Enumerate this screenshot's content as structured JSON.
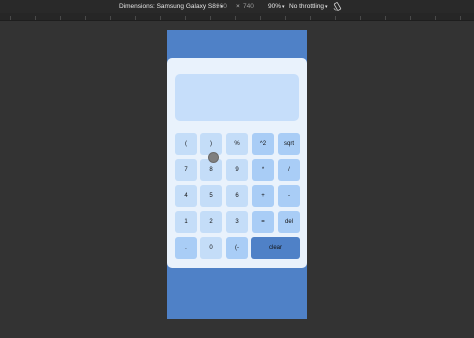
{
  "devtools": {
    "dimensions_label": "Dimensions: Samsung Galaxy S8+",
    "width": "360",
    "times": "×",
    "height": "740",
    "zoom": "90%",
    "throttling": "No throttling"
  },
  "calculator": {
    "display_value": "",
    "keys": {
      "open_paren": "(",
      "close_paren": ")",
      "percent": "%",
      "square": "^2",
      "sqrt": "sqrt",
      "seven": "7",
      "eight": "8",
      "nine": "9",
      "multiply": "*",
      "divide": "/",
      "four": "4",
      "five": "5",
      "six": "6",
      "plus": "+",
      "minus": "-",
      "one": "1",
      "two": "2",
      "three": "3",
      "equals": "=",
      "del": "del",
      "dot": ".",
      "zero": "0",
      "negate": "(-",
      "clear": "clear"
    }
  },
  "colors": {
    "page_background": "#333333",
    "device_background": "#4f81c7",
    "calculator_body": "#e9f2fc",
    "display": "#c6defa",
    "key_light": "#c4ddf8",
    "key_blue": "#a9cdf6",
    "clear_key": "#4f81c7"
  }
}
